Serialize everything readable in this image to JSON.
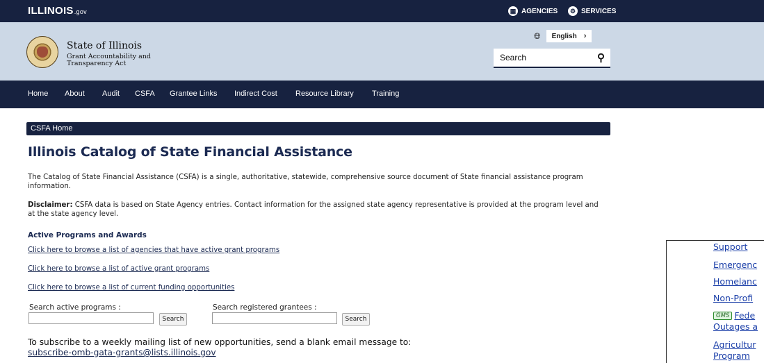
{
  "topbar": {
    "logo_main": "ILLINOIS",
    "logo_suffix": ".gov",
    "agencies_label": "AGENCIES",
    "services_label": "SERVICES"
  },
  "header": {
    "title": "State of Illinois",
    "subtitle_line1": "Grant Accountability and",
    "subtitle_line2": "Transparency Act",
    "language": "English",
    "search_placeholder": "Search"
  },
  "nav": {
    "items": [
      {
        "label": "Home"
      },
      {
        "label": "About"
      },
      {
        "label": "Audit"
      },
      {
        "label": "CSFA"
      },
      {
        "label": "Grantee Links"
      },
      {
        "label": "Indirect Cost"
      },
      {
        "label": "Resource Library"
      },
      {
        "label": "Training"
      }
    ]
  },
  "main": {
    "breadcrumb": "CSFA Home",
    "title": "Illinois Catalog of State Financial Assistance",
    "intro": "The Catalog of State Financial Assistance (CSFA) is a single, authoritative, statewide, comprehensive source document of State financial assistance program information.",
    "disclaimer_label": "Disclaimer:",
    "disclaimer_text": " CSFA data is based on State Agency entries. Contact information for the assigned state agency representative is provided at the program level and at the state agency level.",
    "section_heading": "Active Programs and Awards",
    "links": [
      "Click here to browse a list of agencies that have active grant programs",
      "Click here to browse a list of active grant programs",
      "Click here to browse a list of current funding opportunities"
    ],
    "search_programs_label": "Search active programs :",
    "search_grantees_label": "Search registered grantees :",
    "search_button": "Search",
    "subscribe_text": "To subscribe to a weekly mailing list of new opportunities, send a blank email message to: ",
    "subscribe_email": "subscribe-omb-gata-grants@lists.illinois.gov"
  },
  "panel": {
    "items": [
      "Support",
      "Emergenc",
      "Homelanc",
      "Non-Profi",
      "Fede",
      "Outages a",
      "Agricultur",
      "Program"
    ],
    "gms_badge": "GMS"
  }
}
